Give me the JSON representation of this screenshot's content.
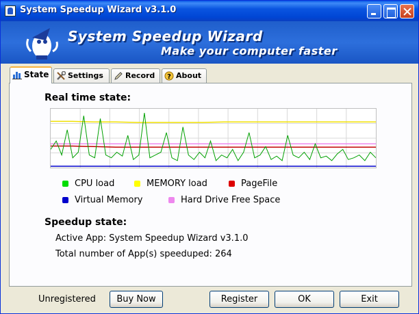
{
  "window": {
    "title": "System Speedup Wizard v3.1.0"
  },
  "banner": {
    "title": "System Speedup Wizard",
    "subtitle": "Make your computer faster"
  },
  "tabs": [
    {
      "label": "State",
      "icon": "state-icon",
      "active": true
    },
    {
      "label": "Settings",
      "icon": "tools-icon",
      "active": false
    },
    {
      "label": "Record",
      "icon": "pencil-icon",
      "active": false
    },
    {
      "label": "About",
      "icon": "help-icon",
      "active": false
    }
  ],
  "state": {
    "realtime_label": "Real time state:",
    "speedup_label": "Speedup state:",
    "active_app_label": "Active App:",
    "active_app_value": "System Speedup Wizard v3.1.0",
    "total_label": "Total number of App(s) speeduped:",
    "total_value": "264"
  },
  "legend": [
    {
      "label": "CPU load",
      "color": "#00cc00"
    },
    {
      "label": "MEMORY load",
      "color": "#ffff00"
    },
    {
      "label": "PageFile",
      "color": "#cc0000"
    },
    {
      "label": "Virtual Memory",
      "color": "#0000cc"
    },
    {
      "label": "Hard Drive Free Space",
      "color": "#ee88ee"
    }
  ],
  "chart_data": {
    "type": "line",
    "ylim": [
      0,
      100
    ],
    "grid": true,
    "series": [
      {
        "name": "MEMORY load",
        "color": "#f0e000",
        "values": [
          80,
          80,
          79,
          79,
          78,
          78,
          78,
          78,
          79,
          79,
          79,
          79,
          79,
          79,
          79,
          79
        ]
      },
      {
        "name": "PageFile",
        "color": "#c00000",
        "values": [
          36,
          36,
          35,
          34,
          34,
          34,
          34,
          34,
          34,
          34,
          34,
          34,
          34,
          34,
          34,
          34
        ]
      },
      {
        "name": "Hard Drive Free Space",
        "color": "#ee88ee",
        "values": [
          40,
          40,
          40,
          40,
          40,
          40,
          40,
          40,
          40,
          40,
          40,
          40,
          40,
          40,
          40,
          40
        ]
      },
      {
        "name": "Virtual Memory",
        "color": "#0000cc",
        "values": [
          0,
          0,
          0,
          0,
          0,
          0,
          0,
          0,
          0,
          0,
          0,
          0,
          0,
          0,
          0,
          0
        ]
      },
      {
        "name": "CPU load",
        "color": "#00a000",
        "values": [
          30,
          45,
          20,
          65,
          15,
          25,
          90,
          20,
          15,
          85,
          20,
          15,
          25,
          18,
          55,
          12,
          20,
          95,
          15,
          20,
          25,
          60,
          15,
          10,
          70,
          20,
          12,
          25,
          15,
          45,
          10,
          20,
          15,
          30,
          10,
          25,
          60,
          15,
          20,
          35,
          12,
          18,
          10,
          55,
          20,
          15,
          25,
          12,
          40,
          15,
          18,
          10,
          22,
          30,
          12,
          15,
          20,
          10,
          25,
          15
        ]
      }
    ]
  },
  "footer": {
    "status": "Unregistered",
    "buy_label": "Buy Now",
    "register_label": "Register",
    "ok_label": "OK",
    "exit_label": "Exit"
  }
}
